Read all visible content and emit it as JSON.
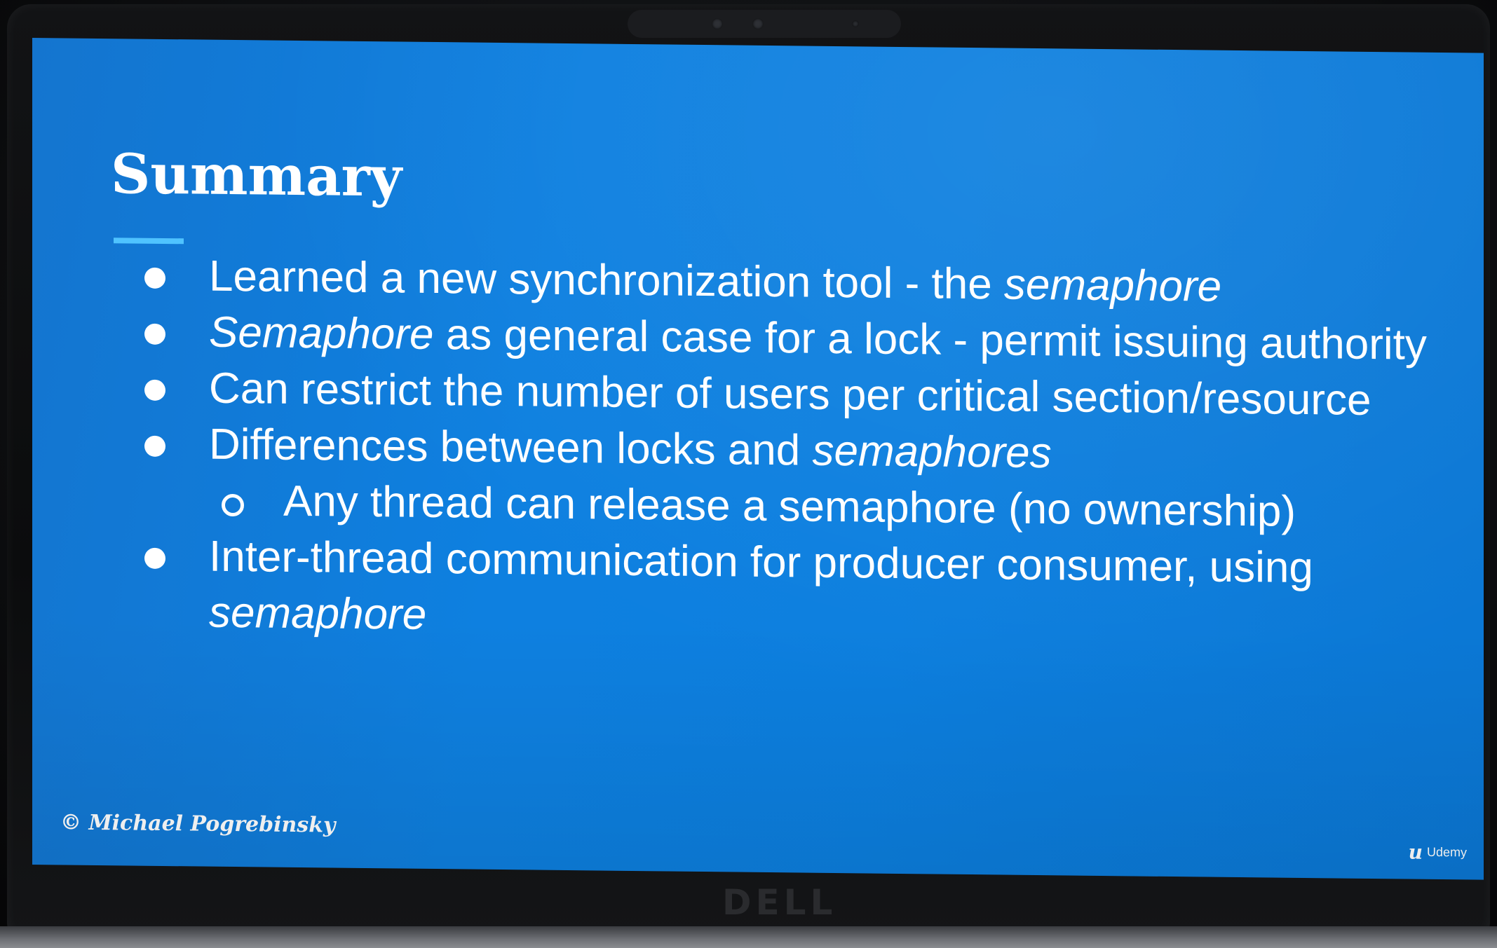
{
  "slide": {
    "title": "Summary",
    "bullets": [
      {
        "prefix": "Learned a new synchronization tool - the ",
        "italic": "semaphore",
        "suffix": ""
      },
      {
        "prefix": "",
        "italic": "Semaphore",
        "suffix": " as general case for a lock - permit issuing authority"
      },
      {
        "prefix": "Can restrict the number of users per critical section/resource",
        "italic": "",
        "suffix": ""
      },
      {
        "prefix": "Differences between locks and ",
        "italic": "semaphores",
        "suffix": ""
      },
      {
        "prefix": "Any thread can release a semaphore (no ownership)",
        "italic": "",
        "suffix": ""
      },
      {
        "prefix": "Inter-thread communication for producer consumer, using ",
        "italic": "semaphore",
        "suffix": ""
      }
    ],
    "copyright": "© Michael Pogrebinsky",
    "udemy_mark": "u",
    "udemy_label": "Udemy"
  },
  "laptop": {
    "brand": "DELL"
  },
  "colors": {
    "slide_background": "#0c7fdf",
    "title_rule": "#4fc3ff",
    "text": "#ffffff"
  }
}
